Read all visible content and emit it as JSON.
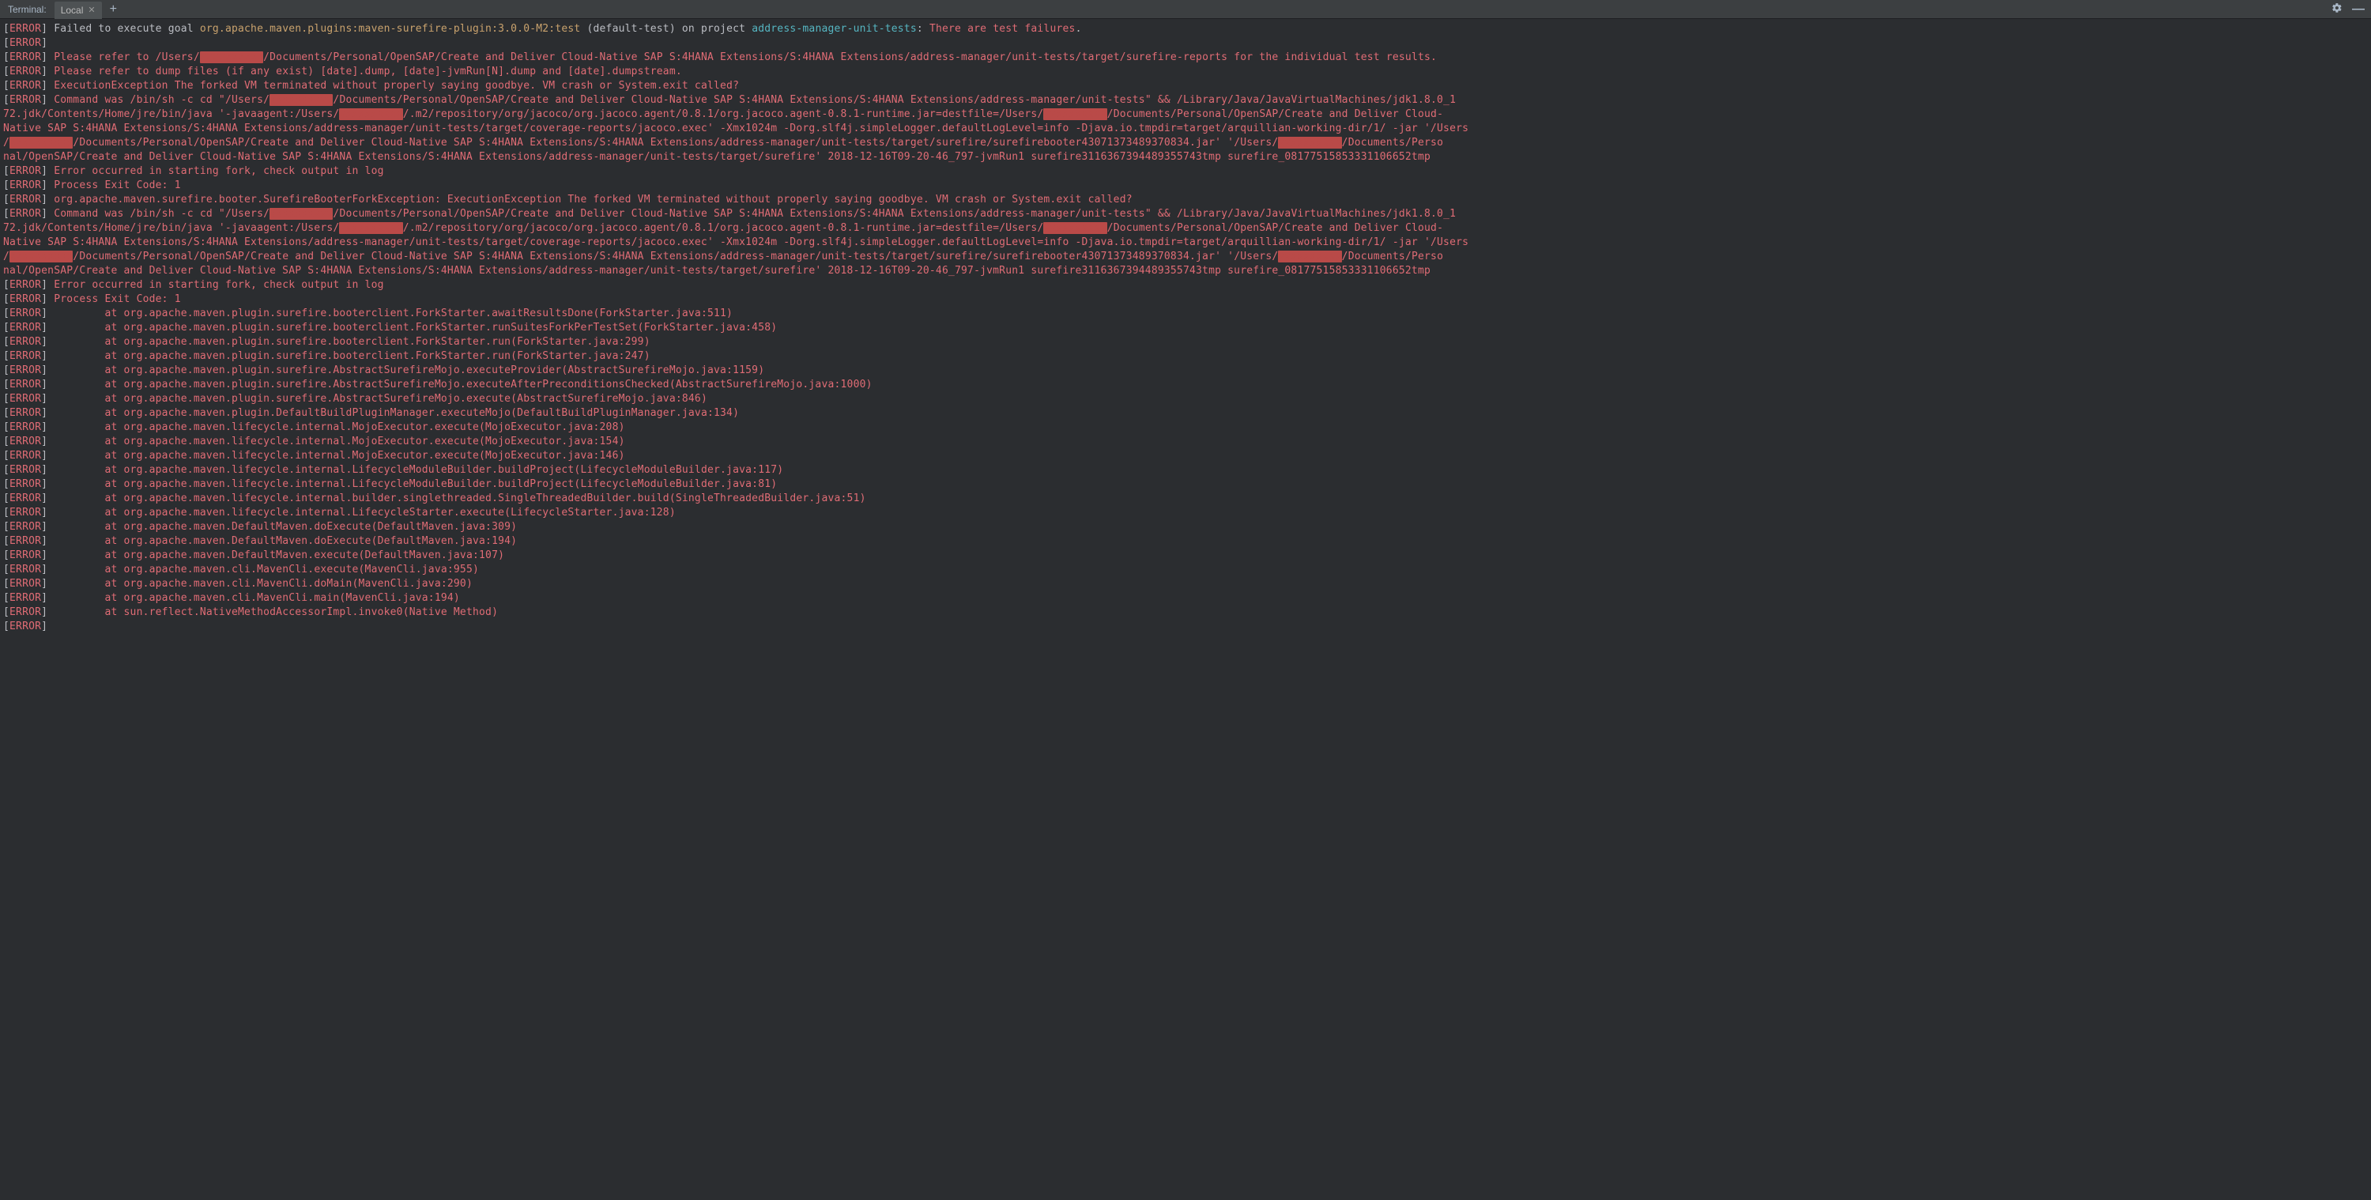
{
  "header": {
    "title": "Terminal:",
    "tab_label": "Local"
  },
  "redacted": "xxxxxxxxxx",
  "l1": {
    "a": " Failed to execute goal ",
    "b": "org.apache.maven.plugins:maven-surefire-plugin:3.0.0-M2:test",
    "c": " (default-test)",
    "d": " on project ",
    "e": "address-manager-unit-tests",
    "f": ": ",
    "g": "There are test failures",
    "h": "."
  },
  "l3a": " Please refer to /Users/",
  "l3b": "/Documents/Personal/OpenSAP/Create and Deliver Cloud-Native SAP S:4HANA Extensions/S:4HANA Extensions/address-manager/unit-tests/target/surefire-reports for the individual test results.",
  "l4": " Please refer to dump files (if any exist) [date].dump, [date]-jvmRun[N].dump and [date].dumpstream.",
  "l5": " ExecutionException The forked VM terminated without properly saying goodbye. VM crash or System.exit called?",
  "l6a": " Command was /bin/sh -c cd \"/Users/",
  "l6b": "/Documents/Personal/OpenSAP/Create and Deliver Cloud-Native SAP S:4HANA Extensions/S:4HANA Extensions/address-manager/unit-tests\" && /Library/Java/JavaVirtualMachines/jdk1.8.0_1",
  "l7a": "72.jdk/Contents/Home/jre/bin/java '-javaagent:/Users/",
  "l7b": "/.m2/repository/org/jacoco/org.jacoco.agent/0.8.1/org.jacoco.agent-0.8.1-runtime.jar=destfile=/Users/",
  "l7c": "/Documents/Personal/OpenSAP/Create and Deliver Cloud-",
  "l8a": "Native SAP S:4HANA Extensions/S:4HANA Extensions/address-manager/unit-tests/target/coverage-reports/jacoco.exec' -Xmx1024m -Dorg.slf4j.simpleLogger.defaultLogLevel=info -Djava.io.tmpdir=target/arquillian-working-dir/1/ -jar '/Users",
  "l9a": "/",
  "l9b": "/Documents/Personal/OpenSAP/Create and Deliver Cloud-Native SAP S:4HANA Extensions/S:4HANA Extensions/address-manager/unit-tests/target/surefire/surefirebooter43071373489370834.jar' '/Users/",
  "l9c": "/Documents/Perso",
  "l10": "nal/OpenSAP/Create and Deliver Cloud-Native SAP S:4HANA Extensions/S:4HANA Extensions/address-manager/unit-tests/target/surefire' 2018-12-16T09-20-46_797-jvmRun1 surefire3116367394489355743tmp surefire_08177515853331106652tmp",
  "l11": " Error occurred in starting fork, check output in log",
  "l12": " Process Exit Code: 1",
  "l13": " org.apache.maven.surefire.booter.SurefireBooterForkException: ExecutionException The forked VM terminated without properly saying goodbye. VM crash or System.exit called?",
  "stack": [
    "at org.apache.maven.plugin.surefire.booterclient.ForkStarter.awaitResultsDone(ForkStarter.java:511)",
    "at org.apache.maven.plugin.surefire.booterclient.ForkStarter.runSuitesForkPerTestSet(ForkStarter.java:458)",
    "at org.apache.maven.plugin.surefire.booterclient.ForkStarter.run(ForkStarter.java:299)",
    "at org.apache.maven.plugin.surefire.booterclient.ForkStarter.run(ForkStarter.java:247)",
    "at org.apache.maven.plugin.surefire.AbstractSurefireMojo.executeProvider(AbstractSurefireMojo.java:1159)",
    "at org.apache.maven.plugin.surefire.AbstractSurefireMojo.executeAfterPreconditionsChecked(AbstractSurefireMojo.java:1000)",
    "at org.apache.maven.plugin.surefire.AbstractSurefireMojo.execute(AbstractSurefireMojo.java:846)",
    "at org.apache.maven.plugin.DefaultBuildPluginManager.executeMojo(DefaultBuildPluginManager.java:134)",
    "at org.apache.maven.lifecycle.internal.MojoExecutor.execute(MojoExecutor.java:208)",
    "at org.apache.maven.lifecycle.internal.MojoExecutor.execute(MojoExecutor.java:154)",
    "at org.apache.maven.lifecycle.internal.MojoExecutor.execute(MojoExecutor.java:146)",
    "at org.apache.maven.lifecycle.internal.LifecycleModuleBuilder.buildProject(LifecycleModuleBuilder.java:117)",
    "at org.apache.maven.lifecycle.internal.LifecycleModuleBuilder.buildProject(LifecycleModuleBuilder.java:81)",
    "at org.apache.maven.lifecycle.internal.builder.singlethreaded.SingleThreadedBuilder.build(SingleThreadedBuilder.java:51)",
    "at org.apache.maven.lifecycle.internal.LifecycleStarter.execute(LifecycleStarter.java:128)",
    "at org.apache.maven.DefaultMaven.doExecute(DefaultMaven.java:309)",
    "at org.apache.maven.DefaultMaven.doExecute(DefaultMaven.java:194)",
    "at org.apache.maven.DefaultMaven.execute(DefaultMaven.java:107)",
    "at org.apache.maven.cli.MavenCli.execute(MavenCli.java:955)",
    "at org.apache.maven.cli.MavenCli.doMain(MavenCli.java:290)",
    "at org.apache.maven.cli.MavenCli.main(MavenCli.java:194)",
    "at sun.reflect.NativeMethodAccessorImpl.invoke0(Native Method)"
  ],
  "error_label": "ERROR",
  "stack_indent": "         "
}
